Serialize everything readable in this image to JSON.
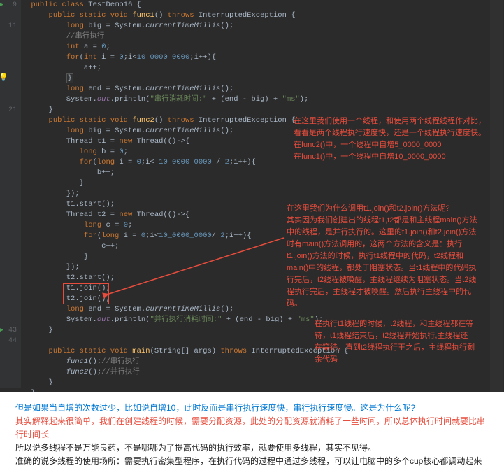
{
  "class_decl": {
    "kw_public": "public",
    "kw_class": "class",
    "name": "TestDemo16",
    "brace": "{"
  },
  "f1_sig": {
    "kw_public": "public",
    "kw_static": "static",
    "kw_void": "void",
    "name": "func1",
    "paren": "()",
    "kw_throws": "throws",
    "exc": "InterruptedException",
    "brace": "{"
  },
  "f1_long": {
    "kw": "long",
    "var": "big",
    "eq": "=",
    "cls": "System",
    "dot": ".",
    "mth": "currentTimeMillis",
    "end": "();"
  },
  "f1_com": "//串行执行",
  "f1_int": {
    "kw": "int",
    "var": "a",
    "eq": "=",
    "val": "0",
    "semi": ";"
  },
  "f1_for": {
    "kw": "for",
    "p1": "(",
    "kw2": "int",
    "var": "i",
    "eq": "=",
    "v0": "0",
    "s1": ";",
    "cond": "i<",
    "v10": "10_0000_0000",
    "s2": ";",
    "inc": "i++",
    "p2": "){"
  },
  "f1_inc": "a++;",
  "f1_close": "}",
  "f1_end": {
    "kw": "long",
    "var": "end",
    "eq": "=",
    "cls": "System",
    "dot": ".",
    "mth": "currentTimeMillis",
    "end": "();"
  },
  "f1_print": {
    "cls": "System",
    "dot1": ".",
    "out": "out",
    "dot2": ".",
    "mth": "println",
    "p1": "(",
    "str": "\"串行消耗时间:\"",
    "plus1": " + (end - big) + ",
    "ms": "\"ms\"",
    "p2": ");"
  },
  "f1_brace": "}",
  "f2_sig": {
    "kw_public": "public",
    "kw_static": "static",
    "kw_void": "void",
    "name": "func2",
    "paren": "()",
    "kw_throws": "throws",
    "exc": "InterruptedException",
    "brace": "{"
  },
  "f2_long": {
    "kw": "long",
    "var": "big",
    "eq": "=",
    "cls": "System",
    "dot": ".",
    "mth": "currentTimeMillis",
    "end": "();"
  },
  "f2_t1": {
    "cls": "Thread",
    "var": "t1",
    "eq": "=",
    "kw": "new",
    "cls2": "Thread",
    "lam": "(()->{"
  },
  "f2_b": {
    "kw": "long",
    "var": "b",
    "eq": "=",
    "v": "0",
    "semi": ";"
  },
  "f2_for1": {
    "kw": "for",
    "p1": "(",
    "kw2": "long",
    "var": "i",
    "eq": "= ",
    "v0": "0",
    "s1": ";",
    "cond": "i< ",
    "v": "10_0000_0000",
    "div": " / ",
    "two": "2",
    "s2": ";",
    "inc": "i++",
    "p2": "){"
  },
  "f2_binc": "b++;",
  "f2_c1": "}",
  "f2_c2": "});",
  "f2_start1": "t1.start();",
  "f2_t2": {
    "cls": "Thread",
    "var": "t2",
    "eq": "=",
    "kw": "new",
    "cls2": "Thread",
    "lam": "(()->{"
  },
  "f2_c": {
    "kw": "long",
    "var": "c",
    "eq": "=",
    "v": "0",
    "semi": ";"
  },
  "f2_for2": {
    "kw": "for",
    "p1": "(",
    "kw2": "long",
    "var": "i",
    "eq": "= ",
    "v0": "0",
    "s1": ";",
    "cond": "i<",
    "v": "10_0000_0000",
    "div": "/ ",
    "two": "2",
    "s2": ";",
    "inc": "i++",
    "p2": "){"
  },
  "f2_cinc": "c++;",
  "f2_c3": "}",
  "f2_c4": "});",
  "f2_start2": "t2.start();",
  "f2_join1": "t1.join();",
  "f2_join2": "t2.join();",
  "f2_end": {
    "kw": "long",
    "var": "end",
    "eq": "=",
    "cls": "System",
    "dot": ".",
    "mth": "currentTimeMillis",
    "end": "();"
  },
  "f2_print": {
    "cls": "System",
    "dot1": ".",
    "out": "out",
    "dot2": ".",
    "mth": "println",
    "p1": "(",
    "str": "\"并行执行消耗时间:\"",
    "plus1": " + (end - big) + ",
    "ms": "\"ms\"",
    "p2": ");"
  },
  "f2_brace": "}",
  "main_sig": {
    "kw_public": "public",
    "kw_static": "static",
    "kw_void": "void",
    "name": "main",
    "p1": "(",
    "arg": "String[] args",
    "p2": ")",
    "kw_throws": "throws",
    "exc": "InterruptedException",
    "brace": "{"
  },
  "main_f1": {
    "call": "func1",
    "rest": "();",
    "com": "//串行执行"
  },
  "main_f2": {
    "call": "func2",
    "rest": "();",
    "com": "//并行执行"
  },
  "main_brace": "}",
  "final_brace": "}",
  "line_numbers": [
    "9",
    "",
    "11",
    "",
    "",
    "",
    "",
    "",
    "",
    "",
    "21",
    "",
    "",
    "",
    "",
    "",
    "",
    "",
    "",
    "",
    "",
    "",
    "",
    "",
    "",
    "",
    "",
    "",
    "",
    "",
    "",
    "43",
    "44",
    "",
    "",
    "",
    ""
  ],
  "bulb_line": 7,
  "run_lines": [
    0,
    31
  ],
  "overlay1": "在这里我们使用一个线程，和使用两个线程线程作对比，看看是两个线程执行速度快，还是一个线程执行速度快。\n在func2()中，一个线程中自增5_0000_0000\n在func1()中，一个线程中自增10_0000_0000",
  "overlay2": "在这里我们为什么调用t1.join()和t2.join()方法呢?\n其实因为我们创建出的线程t1,t2都是和主线程main()方法中的线程，是并行执行的。这里的t1.join()和t2.join()方法时有main()方法调用的，这两个方法的含义是：执行t1.join()方法的时候，执行t1线程中的代码，t2线程和main()中的线程，都处于阻塞状态。当t1线程中的代码执行完后，t2线程被唤醒，主线程继续为阻塞状态。当t2线程执行完后，主线程才被唤醒。然后执行主线程中的代码。",
  "overlay3": "在执行t1线程的时候，t2线程，和主线程都在等待，t1线程结束后，t2线程开始执行,主线程还在等待，直到t2线程执行王之后，主线程执行剩余代码",
  "footer": {
    "l1": "但是如果当自增的次数过少，比如说自增10，此时反而是串行执行速度快，串行执行速度慢。这是为什么呢?",
    "l2": "其实解释起来很简单，我们在创建线程的时候，需要分配资源，此处的分配资源就消耗了一些时间，所以总体执行时间就要比串行时间长",
    "l3": "所以说多线程不是万能良药，不是哪哪为了提高代码的执行效率，就要使用多线程，其实不见得。",
    "l4": "准确的说多线程的使用场所：需要执行密集型程序，在执行代码的过程中通过多线程，可以让电脑中的多个cup核心都调动起来"
  }
}
